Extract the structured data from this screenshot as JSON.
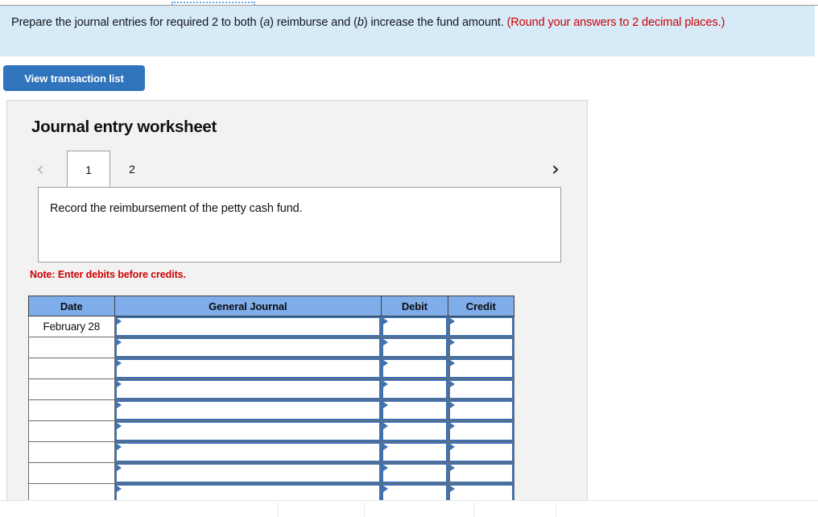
{
  "top_strip": {
    "dotted_tab_label": ""
  },
  "instruction": {
    "text_before_a": "Prepare the journal entries for required 2 to both (",
    "italic_a": "a",
    "text_mid": ") reimburse and (",
    "italic_b": "b",
    "text_after_b": ") increase the fund amount. ",
    "warning": "(Round your answers to 2 decimal places.)",
    "full_text": "Prepare the journal entries for required 2 to both (a) reimburse and (b) increase the fund amount. (Round your answers to 2 decimal places.)",
    "background_color": "#d7eaf8",
    "warning_color": "#cc0000"
  },
  "toolbar": {
    "view_transaction_list_label": "View transaction list",
    "button_color": "#2f74bd"
  },
  "worksheet": {
    "title": "Journal entry worksheet",
    "panel_background": "#f2f2f2",
    "tabs": [
      {
        "label": "1",
        "active": true
      },
      {
        "label": "2",
        "active": false
      }
    ],
    "prev_arrow": "‹",
    "next_arrow": "›",
    "prev_enabled": false,
    "next_enabled": true,
    "description": "Record the reimbursement of the petty cash fund.",
    "note": "Note: Enter debits before credits.",
    "note_color": "#cc0000"
  },
  "journal_table": {
    "header_color": "#7fadea",
    "input_border_color": "#3f72b2",
    "columns": [
      "Date",
      "General Journal",
      "Debit",
      "Credit"
    ],
    "rows": [
      {
        "date": "February 28",
        "general_journal": "",
        "debit": "",
        "credit": ""
      },
      {
        "date": "",
        "general_journal": "",
        "debit": "",
        "credit": ""
      },
      {
        "date": "",
        "general_journal": "",
        "debit": "",
        "credit": ""
      },
      {
        "date": "",
        "general_journal": "",
        "debit": "",
        "credit": ""
      },
      {
        "date": "",
        "general_journal": "",
        "debit": "",
        "credit": ""
      },
      {
        "date": "",
        "general_journal": "",
        "debit": "",
        "credit": ""
      },
      {
        "date": "",
        "general_journal": "",
        "debit": "",
        "credit": ""
      },
      {
        "date": "",
        "general_journal": "",
        "debit": "",
        "credit": ""
      },
      {
        "date": "",
        "general_journal": "",
        "debit": "",
        "credit": ""
      }
    ]
  }
}
